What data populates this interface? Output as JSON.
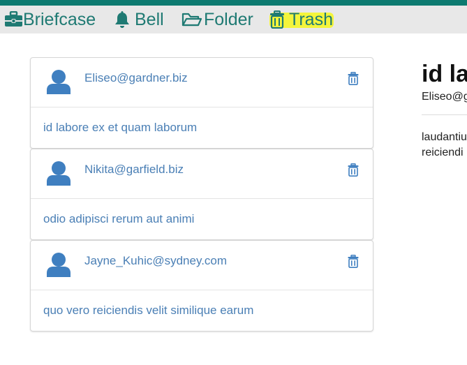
{
  "nav": {
    "items": [
      {
        "label": "Briefcase",
        "icon": "briefcase-icon"
      },
      {
        "label": "Bell",
        "icon": "bell-icon"
      },
      {
        "label": "Folder",
        "icon": "folder-icon"
      },
      {
        "label": "Trash",
        "icon": "trash-icon"
      }
    ]
  },
  "messages": [
    {
      "email": "Eliseo@gardner.biz",
      "subject": "id labore ex et quam laborum"
    },
    {
      "email": "Nikita@garfield.biz",
      "subject": "odio adipisci rerum aut animi"
    },
    {
      "email": "Jayne_Kuhic@sydney.com",
      "subject": "quo vero reiciendis velit similique earum"
    }
  ],
  "detail": {
    "title": "id la",
    "email": "Eliseo@g",
    "body_line1": "laudantiu",
    "body_line2": "reiciendi"
  },
  "colors": {
    "accent_bar": "#0d7a70",
    "nav_text": "#1f7a73",
    "link_blue": "#4a7fb5",
    "highlight": "#f4f53b"
  }
}
